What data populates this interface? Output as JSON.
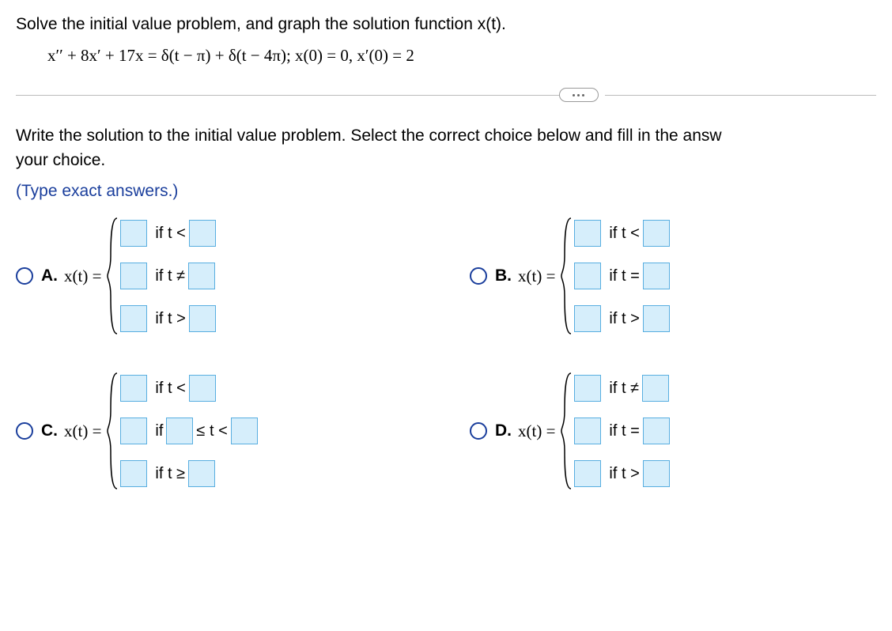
{
  "problem": {
    "title": "Solve the initial value problem, and graph the solution function x(t).",
    "equation": "x′′ + 8x′ + 17x = δ(t − π) + δ(t − 4π);    x(0) = 0, x′(0) = 2"
  },
  "question": {
    "text_line1": "Write the solution to the initial value problem. Select the correct choice below and fill in the answ",
    "text_line2": "your choice.",
    "hint": "(Type exact answers.)"
  },
  "choices": {
    "A": {
      "label": "A.",
      "lhs": "x(t) = ",
      "cases": [
        {
          "cond_pre": "if t <"
        },
        {
          "cond_pre": "if t ≠"
        },
        {
          "cond_pre": "if t >"
        }
      ]
    },
    "B": {
      "label": "B.",
      "lhs": "x(t) = ",
      "cases": [
        {
          "cond_pre": "if t <"
        },
        {
          "cond_pre": "if t ="
        },
        {
          "cond_pre": "if t >"
        }
      ]
    },
    "C": {
      "label": "C.",
      "lhs": "x(t) = ",
      "cases": [
        {
          "cond_pre": "if t <"
        },
        {
          "cond_pre": "if",
          "between": "≤ t <"
        },
        {
          "cond_pre": "if t ≥"
        }
      ]
    },
    "D": {
      "label": "D.",
      "lhs": "x(t) = ",
      "cases": [
        {
          "cond_pre": "if t ≠"
        },
        {
          "cond_pre": "if t ="
        },
        {
          "cond_pre": "if t >"
        }
      ]
    }
  }
}
